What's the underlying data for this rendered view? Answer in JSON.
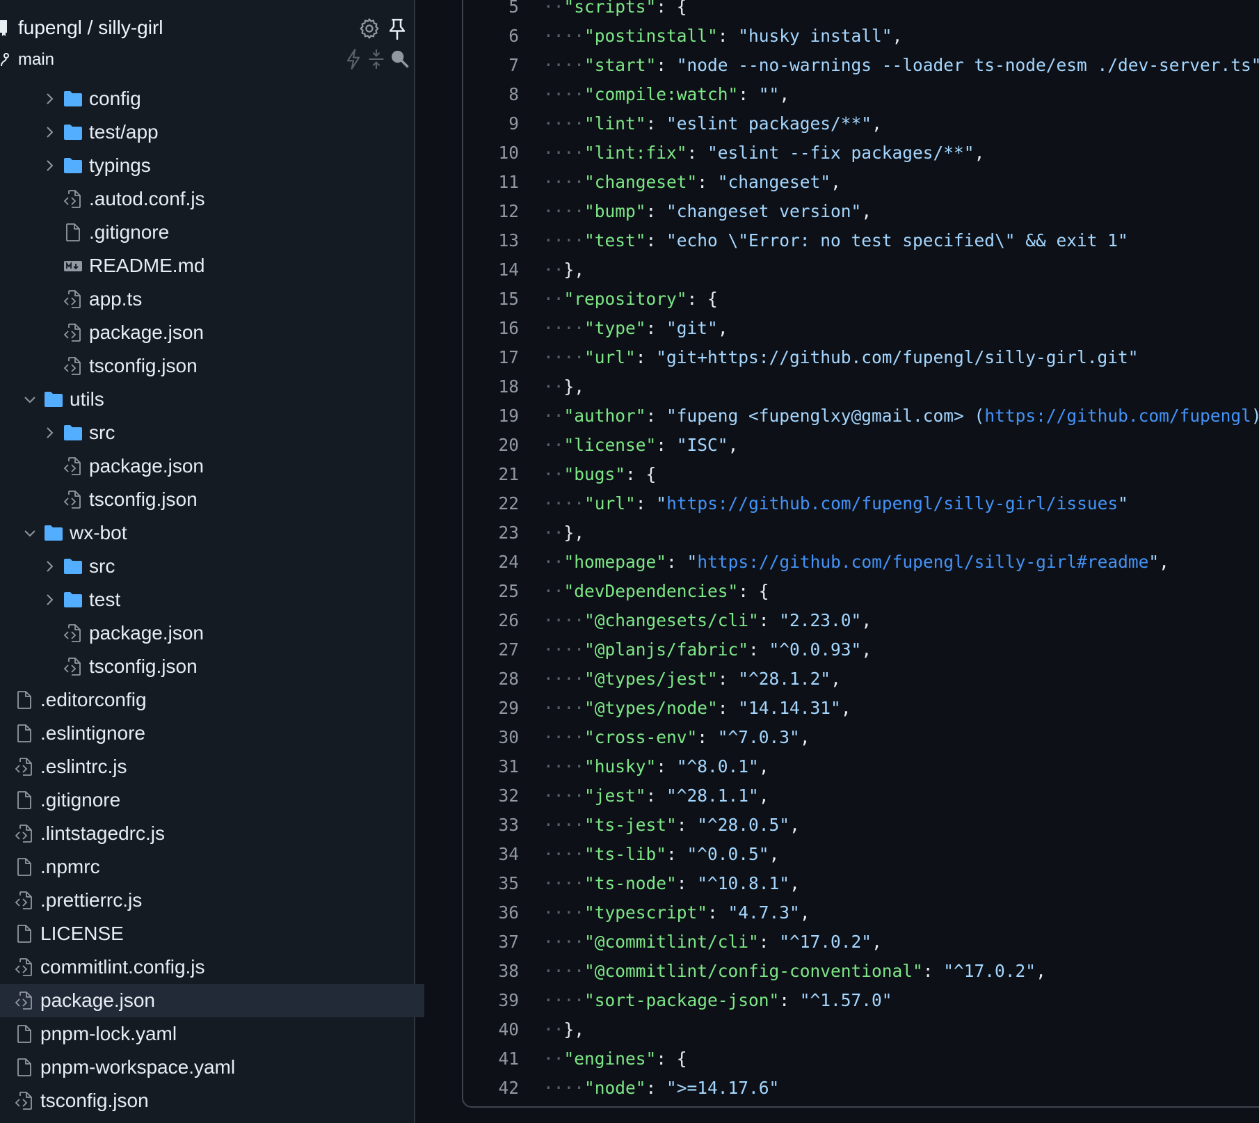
{
  "header": {
    "repo": "fupengl / silly-girl",
    "branch": "main"
  },
  "tree": [
    {
      "name": "config",
      "type": "folder",
      "depth": 2,
      "expanded": false
    },
    {
      "name": "test/app",
      "type": "folder",
      "depth": 2,
      "expanded": false
    },
    {
      "name": "typings",
      "type": "folder",
      "depth": 2,
      "expanded": false
    },
    {
      "name": ".autod.conf.js",
      "type": "code",
      "depth": 2
    },
    {
      "name": ".gitignore",
      "type": "file",
      "depth": 2
    },
    {
      "name": "README.md",
      "type": "markdown",
      "depth": 2
    },
    {
      "name": "app.ts",
      "type": "code",
      "depth": 2
    },
    {
      "name": "package.json",
      "type": "code",
      "depth": 2
    },
    {
      "name": "tsconfig.json",
      "type": "code",
      "depth": 2
    },
    {
      "name": "utils",
      "type": "folder",
      "depth": 1,
      "expanded": true
    },
    {
      "name": "src",
      "type": "folder",
      "depth": 2,
      "expanded": false
    },
    {
      "name": "package.json",
      "type": "code",
      "depth": 2
    },
    {
      "name": "tsconfig.json",
      "type": "code",
      "depth": 2
    },
    {
      "name": "wx-bot",
      "type": "folder",
      "depth": 1,
      "expanded": true
    },
    {
      "name": "src",
      "type": "folder",
      "depth": 2,
      "expanded": false
    },
    {
      "name": "test",
      "type": "folder",
      "depth": 2,
      "expanded": false
    },
    {
      "name": "package.json",
      "type": "code",
      "depth": 2
    },
    {
      "name": "tsconfig.json",
      "type": "code",
      "depth": 2
    },
    {
      "name": ".editorconfig",
      "type": "file",
      "depth": 0
    },
    {
      "name": ".eslintignore",
      "type": "file",
      "depth": 0
    },
    {
      "name": ".eslintrc.js",
      "type": "code",
      "depth": 0
    },
    {
      "name": ".gitignore",
      "type": "file",
      "depth": 0
    },
    {
      "name": ".lintstagedrc.js",
      "type": "code",
      "depth": 0
    },
    {
      "name": ".npmrc",
      "type": "file",
      "depth": 0
    },
    {
      "name": ".prettierrc.js",
      "type": "code",
      "depth": 0
    },
    {
      "name": "LICENSE",
      "type": "file",
      "depth": 0
    },
    {
      "name": "commitlint.config.js",
      "type": "code",
      "depth": 0
    },
    {
      "name": "package.json",
      "type": "code",
      "depth": 0,
      "selected": true
    },
    {
      "name": "pnpm-lock.yaml",
      "type": "file",
      "depth": 0
    },
    {
      "name": "pnpm-workspace.yaml",
      "type": "file",
      "depth": 0
    },
    {
      "name": "tsconfig.json",
      "type": "code",
      "depth": 0
    }
  ],
  "code": {
    "first_line": 5,
    "lines": [
      [
        [
          "ws",
          "··"
        ],
        [
          "key",
          "\"scripts\""
        ],
        [
          "pun",
          ": {"
        ]
      ],
      [
        [
          "ws",
          "····"
        ],
        [
          "key",
          "\"postinstall\""
        ],
        [
          "pun",
          ": "
        ],
        [
          "str",
          "\"husky install\""
        ],
        [
          "pun",
          ","
        ]
      ],
      [
        [
          "ws",
          "····"
        ],
        [
          "key",
          "\"start\""
        ],
        [
          "pun",
          ": "
        ],
        [
          "str",
          "\"node --no-warnings --loader ts-node/esm ./dev-server.ts\""
        ],
        [
          "pun",
          ","
        ]
      ],
      [
        [
          "ws",
          "····"
        ],
        [
          "key",
          "\"compile:watch\""
        ],
        [
          "pun",
          ": "
        ],
        [
          "str",
          "\"\""
        ],
        [
          "pun",
          ","
        ]
      ],
      [
        [
          "ws",
          "····"
        ],
        [
          "key",
          "\"lint\""
        ],
        [
          "pun",
          ": "
        ],
        [
          "str",
          "\"eslint packages/**\""
        ],
        [
          "pun",
          ","
        ]
      ],
      [
        [
          "ws",
          "····"
        ],
        [
          "key",
          "\"lint:fix\""
        ],
        [
          "pun",
          ": "
        ],
        [
          "str",
          "\"eslint --fix packages/**\""
        ],
        [
          "pun",
          ","
        ]
      ],
      [
        [
          "ws",
          "····"
        ],
        [
          "key",
          "\"changeset\""
        ],
        [
          "pun",
          ": "
        ],
        [
          "str",
          "\"changeset\""
        ],
        [
          "pun",
          ","
        ]
      ],
      [
        [
          "ws",
          "····"
        ],
        [
          "key",
          "\"bump\""
        ],
        [
          "pun",
          ": "
        ],
        [
          "str",
          "\"changeset version\""
        ],
        [
          "pun",
          ","
        ]
      ],
      [
        [
          "ws",
          "····"
        ],
        [
          "key",
          "\"test\""
        ],
        [
          "pun",
          ": "
        ],
        [
          "str",
          "\"echo \\\"Error: no test specified\\\" && exit 1\""
        ]
      ],
      [
        [
          "ws",
          "··"
        ],
        [
          "pun",
          "},"
        ]
      ],
      [
        [
          "ws",
          "··"
        ],
        [
          "key",
          "\"repository\""
        ],
        [
          "pun",
          ": {"
        ]
      ],
      [
        [
          "ws",
          "····"
        ],
        [
          "key",
          "\"type\""
        ],
        [
          "pun",
          ": "
        ],
        [
          "str",
          "\"git\""
        ],
        [
          "pun",
          ","
        ]
      ],
      [
        [
          "ws",
          "····"
        ],
        [
          "key",
          "\"url\""
        ],
        [
          "pun",
          ": "
        ],
        [
          "str",
          "\"git+https://github.com/fupengl/silly-girl.git\""
        ]
      ],
      [
        [
          "ws",
          "··"
        ],
        [
          "pun",
          "},"
        ]
      ],
      [
        [
          "ws",
          "··"
        ],
        [
          "key",
          "\"author\""
        ],
        [
          "pun",
          ": "
        ],
        [
          "str",
          "\"fupeng <fupenglxy@gmail.com> ("
        ],
        [
          "url",
          "https://github.com/fupengl"
        ],
        [
          "str",
          ")\""
        ]
      ],
      [
        [
          "ws",
          "··"
        ],
        [
          "key",
          "\"license\""
        ],
        [
          "pun",
          ": "
        ],
        [
          "str",
          "\"ISC\""
        ],
        [
          "pun",
          ","
        ]
      ],
      [
        [
          "ws",
          "··"
        ],
        [
          "key",
          "\"bugs\""
        ],
        [
          "pun",
          ": {"
        ]
      ],
      [
        [
          "ws",
          "····"
        ],
        [
          "key",
          "\"url\""
        ],
        [
          "pun",
          ": "
        ],
        [
          "str",
          "\""
        ],
        [
          "url",
          "https://github.com/fupengl/silly-girl/issues"
        ],
        [
          "str",
          "\""
        ]
      ],
      [
        [
          "ws",
          "··"
        ],
        [
          "pun",
          "},"
        ]
      ],
      [
        [
          "ws",
          "··"
        ],
        [
          "key",
          "\"homepage\""
        ],
        [
          "pun",
          ": "
        ],
        [
          "str",
          "\""
        ],
        [
          "url",
          "https://github.com/fupengl/silly-girl#readme"
        ],
        [
          "str",
          "\""
        ],
        [
          "pun",
          ","
        ]
      ],
      [
        [
          "ws",
          "··"
        ],
        [
          "key",
          "\"devDependencies\""
        ],
        [
          "pun",
          ": {"
        ]
      ],
      [
        [
          "ws",
          "····"
        ],
        [
          "key",
          "\"@changesets/cli\""
        ],
        [
          "pun",
          ": "
        ],
        [
          "str",
          "\"2.23.0\""
        ],
        [
          "pun",
          ","
        ]
      ],
      [
        [
          "ws",
          "····"
        ],
        [
          "key",
          "\"@planjs/fabric\""
        ],
        [
          "pun",
          ": "
        ],
        [
          "str",
          "\"^0.0.93\""
        ],
        [
          "pun",
          ","
        ]
      ],
      [
        [
          "ws",
          "····"
        ],
        [
          "key",
          "\"@types/jest\""
        ],
        [
          "pun",
          ": "
        ],
        [
          "str",
          "\"^28.1.2\""
        ],
        [
          "pun",
          ","
        ]
      ],
      [
        [
          "ws",
          "····"
        ],
        [
          "key",
          "\"@types/node\""
        ],
        [
          "pun",
          ": "
        ],
        [
          "str",
          "\"14.14.31\""
        ],
        [
          "pun",
          ","
        ]
      ],
      [
        [
          "ws",
          "····"
        ],
        [
          "key",
          "\"cross-env\""
        ],
        [
          "pun",
          ": "
        ],
        [
          "str",
          "\"^7.0.3\""
        ],
        [
          "pun",
          ","
        ]
      ],
      [
        [
          "ws",
          "····"
        ],
        [
          "key",
          "\"husky\""
        ],
        [
          "pun",
          ": "
        ],
        [
          "str",
          "\"^8.0.1\""
        ],
        [
          "pun",
          ","
        ]
      ],
      [
        [
          "ws",
          "····"
        ],
        [
          "key",
          "\"jest\""
        ],
        [
          "pun",
          ": "
        ],
        [
          "str",
          "\"^28.1.1\""
        ],
        [
          "pun",
          ","
        ]
      ],
      [
        [
          "ws",
          "····"
        ],
        [
          "key",
          "\"ts-jest\""
        ],
        [
          "pun",
          ": "
        ],
        [
          "str",
          "\"^28.0.5\""
        ],
        [
          "pun",
          ","
        ]
      ],
      [
        [
          "ws",
          "····"
        ],
        [
          "key",
          "\"ts-lib\""
        ],
        [
          "pun",
          ": "
        ],
        [
          "str",
          "\"^0.0.5\""
        ],
        [
          "pun",
          ","
        ]
      ],
      [
        [
          "ws",
          "····"
        ],
        [
          "key",
          "\"ts-node\""
        ],
        [
          "pun",
          ": "
        ],
        [
          "str",
          "\"^10.8.1\""
        ],
        [
          "pun",
          ","
        ]
      ],
      [
        [
          "ws",
          "····"
        ],
        [
          "key",
          "\"typescript\""
        ],
        [
          "pun",
          ": "
        ],
        [
          "str",
          "\"4.7.3\""
        ],
        [
          "pun",
          ","
        ]
      ],
      [
        [
          "ws",
          "····"
        ],
        [
          "key",
          "\"@commitlint/cli\""
        ],
        [
          "pun",
          ": "
        ],
        [
          "str",
          "\"^17.0.2\""
        ],
        [
          "pun",
          ","
        ]
      ],
      [
        [
          "ws",
          "····"
        ],
        [
          "key",
          "\"@commitlint/config-conventional\""
        ],
        [
          "pun",
          ": "
        ],
        [
          "str",
          "\"^17.0.2\""
        ],
        [
          "pun",
          ","
        ]
      ],
      [
        [
          "ws",
          "····"
        ],
        [
          "key",
          "\"sort-package-json\""
        ],
        [
          "pun",
          ": "
        ],
        [
          "str",
          "\"^1.57.0\""
        ]
      ],
      [
        [
          "ws",
          "··"
        ],
        [
          "pun",
          "},"
        ]
      ],
      [
        [
          "ws",
          "··"
        ],
        [
          "key",
          "\"engines\""
        ],
        [
          "pun",
          ": {"
        ]
      ],
      [
        [
          "ws",
          "····"
        ],
        [
          "key",
          "\"node\""
        ],
        [
          "pun",
          ": "
        ],
        [
          "str",
          "\">=14.17.6\""
        ]
      ],
      [
        [
          "ws",
          "··"
        ],
        [
          "pun",
          "}"
        ]
      ],
      [
        [
          "pun",
          "}"
        ]
      ]
    ]
  },
  "colors": {
    "sidebar_bg": "#151b23",
    "editor_bg": "#0d1117",
    "selected_row": "#212a36",
    "folder_icon": "#54aeff",
    "json_key": "#7ee787",
    "json_string": "#a5d6ff",
    "url": "#4493f8",
    "line_number": "#9198a1"
  }
}
